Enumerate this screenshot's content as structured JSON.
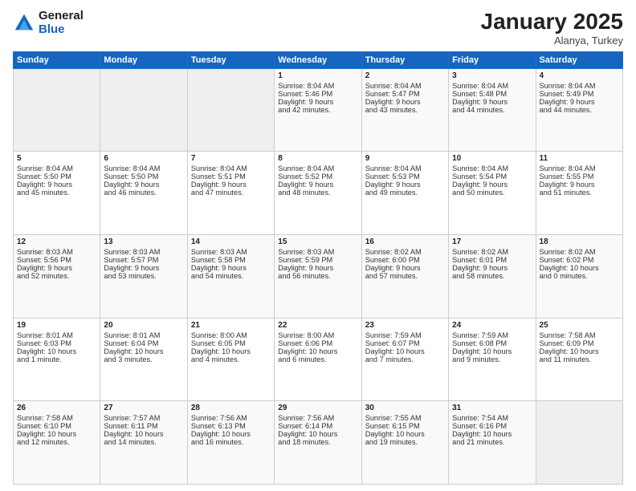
{
  "logo": {
    "general": "General",
    "blue": "Blue"
  },
  "header": {
    "month": "January 2025",
    "location": "Alanya, Turkey"
  },
  "days": [
    "Sunday",
    "Monday",
    "Tuesday",
    "Wednesday",
    "Thursday",
    "Friday",
    "Saturday"
  ],
  "weeks": [
    [
      {
        "day": "",
        "content": ""
      },
      {
        "day": "",
        "content": ""
      },
      {
        "day": "",
        "content": ""
      },
      {
        "day": "1",
        "content": "Sunrise: 8:04 AM\nSunset: 5:46 PM\nDaylight: 9 hours\nand 42 minutes."
      },
      {
        "day": "2",
        "content": "Sunrise: 8:04 AM\nSunset: 5:47 PM\nDaylight: 9 hours\nand 43 minutes."
      },
      {
        "day": "3",
        "content": "Sunrise: 8:04 AM\nSunset: 5:48 PM\nDaylight: 9 hours\nand 44 minutes."
      },
      {
        "day": "4",
        "content": "Sunrise: 8:04 AM\nSunset: 5:49 PM\nDaylight: 9 hours\nand 44 minutes."
      }
    ],
    [
      {
        "day": "5",
        "content": "Sunrise: 8:04 AM\nSunset: 5:50 PM\nDaylight: 9 hours\nand 45 minutes."
      },
      {
        "day": "6",
        "content": "Sunrise: 8:04 AM\nSunset: 5:50 PM\nDaylight: 9 hours\nand 46 minutes."
      },
      {
        "day": "7",
        "content": "Sunrise: 8:04 AM\nSunset: 5:51 PM\nDaylight: 9 hours\nand 47 minutes."
      },
      {
        "day": "8",
        "content": "Sunrise: 8:04 AM\nSunset: 5:52 PM\nDaylight: 9 hours\nand 48 minutes."
      },
      {
        "day": "9",
        "content": "Sunrise: 8:04 AM\nSunset: 5:53 PM\nDaylight: 9 hours\nand 49 minutes."
      },
      {
        "day": "10",
        "content": "Sunrise: 8:04 AM\nSunset: 5:54 PM\nDaylight: 9 hours\nand 50 minutes."
      },
      {
        "day": "11",
        "content": "Sunrise: 8:04 AM\nSunset: 5:55 PM\nDaylight: 9 hours\nand 51 minutes."
      }
    ],
    [
      {
        "day": "12",
        "content": "Sunrise: 8:03 AM\nSunset: 5:56 PM\nDaylight: 9 hours\nand 52 minutes."
      },
      {
        "day": "13",
        "content": "Sunrise: 8:03 AM\nSunset: 5:57 PM\nDaylight: 9 hours\nand 53 minutes."
      },
      {
        "day": "14",
        "content": "Sunrise: 8:03 AM\nSunset: 5:58 PM\nDaylight: 9 hours\nand 54 minutes."
      },
      {
        "day": "15",
        "content": "Sunrise: 8:03 AM\nSunset: 5:59 PM\nDaylight: 9 hours\nand 56 minutes."
      },
      {
        "day": "16",
        "content": "Sunrise: 8:02 AM\nSunset: 6:00 PM\nDaylight: 9 hours\nand 57 minutes."
      },
      {
        "day": "17",
        "content": "Sunrise: 8:02 AM\nSunset: 6:01 PM\nDaylight: 9 hours\nand 58 minutes."
      },
      {
        "day": "18",
        "content": "Sunrise: 8:02 AM\nSunset: 6:02 PM\nDaylight: 10 hours\nand 0 minutes."
      }
    ],
    [
      {
        "day": "19",
        "content": "Sunrise: 8:01 AM\nSunset: 6:03 PM\nDaylight: 10 hours\nand 1 minute."
      },
      {
        "day": "20",
        "content": "Sunrise: 8:01 AM\nSunset: 6:04 PM\nDaylight: 10 hours\nand 3 minutes."
      },
      {
        "day": "21",
        "content": "Sunrise: 8:00 AM\nSunset: 6:05 PM\nDaylight: 10 hours\nand 4 minutes."
      },
      {
        "day": "22",
        "content": "Sunrise: 8:00 AM\nSunset: 6:06 PM\nDaylight: 10 hours\nand 6 minutes."
      },
      {
        "day": "23",
        "content": "Sunrise: 7:59 AM\nSunset: 6:07 PM\nDaylight: 10 hours\nand 7 minutes."
      },
      {
        "day": "24",
        "content": "Sunrise: 7:59 AM\nSunset: 6:08 PM\nDaylight: 10 hours\nand 9 minutes."
      },
      {
        "day": "25",
        "content": "Sunrise: 7:58 AM\nSunset: 6:09 PM\nDaylight: 10 hours\nand 11 minutes."
      }
    ],
    [
      {
        "day": "26",
        "content": "Sunrise: 7:58 AM\nSunset: 6:10 PM\nDaylight: 10 hours\nand 12 minutes."
      },
      {
        "day": "27",
        "content": "Sunrise: 7:57 AM\nSunset: 6:11 PM\nDaylight: 10 hours\nand 14 minutes."
      },
      {
        "day": "28",
        "content": "Sunrise: 7:56 AM\nSunset: 6:13 PM\nDaylight: 10 hours\nand 16 minutes."
      },
      {
        "day": "29",
        "content": "Sunrise: 7:56 AM\nSunset: 6:14 PM\nDaylight: 10 hours\nand 18 minutes."
      },
      {
        "day": "30",
        "content": "Sunrise: 7:55 AM\nSunset: 6:15 PM\nDaylight: 10 hours\nand 19 minutes."
      },
      {
        "day": "31",
        "content": "Sunrise: 7:54 AM\nSunset: 6:16 PM\nDaylight: 10 hours\nand 21 minutes."
      },
      {
        "day": "",
        "content": ""
      }
    ]
  ]
}
